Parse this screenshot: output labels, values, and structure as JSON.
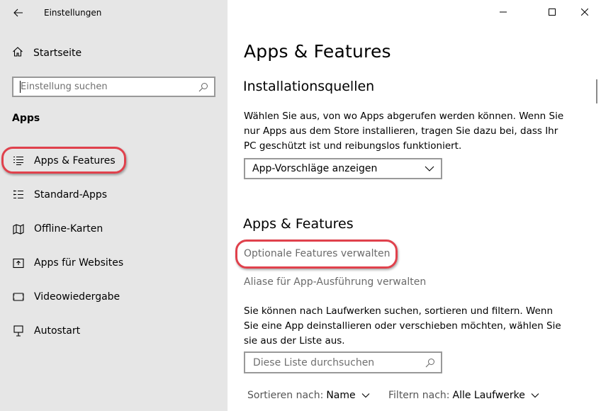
{
  "window": {
    "title": "Einstellungen",
    "controls": {
      "minimize": "minimize-icon",
      "maximize": "maximize-icon",
      "close": "close-icon"
    }
  },
  "sidebar": {
    "home_label": "Startseite",
    "search_placeholder": "Einstellung suchen",
    "section_title": "Apps",
    "items": [
      {
        "label": "Apps & Features",
        "icon": "apps-features-icon",
        "active": true
      },
      {
        "label": "Standard-Apps",
        "icon": "default-apps-icon",
        "active": false
      },
      {
        "label": "Offline-Karten",
        "icon": "map-icon",
        "active": false
      },
      {
        "label": "Apps für Websites",
        "icon": "apps-websites-icon",
        "active": false
      },
      {
        "label": "Videowiedergabe",
        "icon": "video-icon",
        "active": false
      },
      {
        "label": "Autostart",
        "icon": "startup-icon",
        "active": false
      }
    ]
  },
  "main": {
    "page_title": "Apps & Features",
    "install_sources": {
      "heading": "Installationsquellen",
      "description": "Wählen Sie aus, von wo Apps abgerufen werden können. Wenn Sie nur Apps aus dem Store installieren, tragen Sie dazu bei, dass Ihr PC geschützt ist und reibungslos funktioniert.",
      "dropdown_value": "App-Vorschläge anzeigen"
    },
    "apps_features": {
      "heading": "Apps & Features",
      "link_optional": "Optionale Features verwalten",
      "link_aliases": "Aliase für App-Ausführung verwalten",
      "description": "Sie können nach Laufwerken suchen, sortieren und filtern. Wenn Sie eine App deinstallieren oder verschieben möchten, wählen Sie sie aus der Liste aus.",
      "search_placeholder": "Diese Liste durchsuchen",
      "sort_label": "Sortieren nach:",
      "sort_value": "Name",
      "filter_label": "Filtern nach:",
      "filter_value": "Alle Laufwerke"
    }
  },
  "colors": {
    "highlight": "#e0414c",
    "sidebar_bg": "#e6e6e6",
    "link_gray": "#6b6b6b"
  }
}
